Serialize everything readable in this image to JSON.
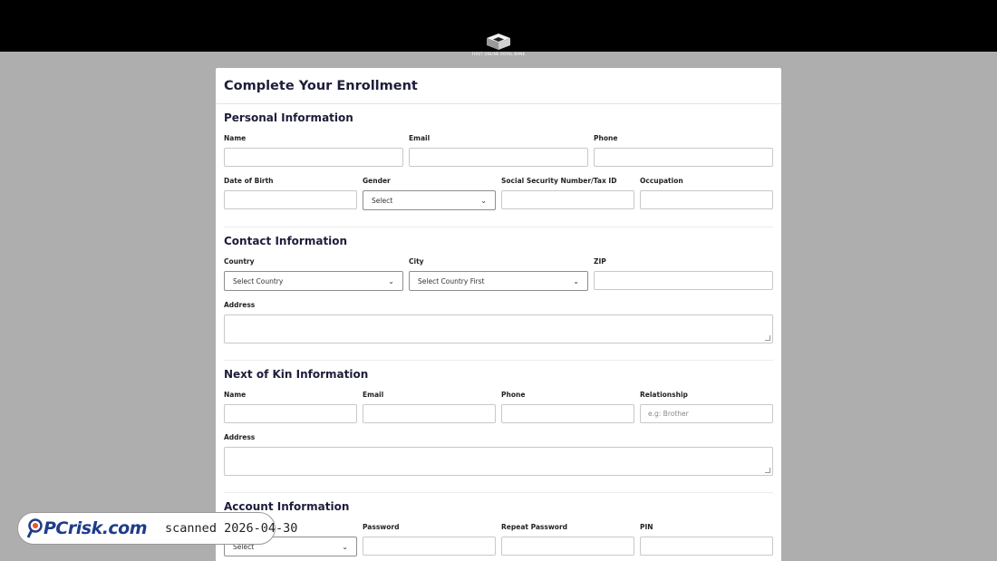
{
  "header": {
    "logo_text": "FIRST ONLINE ROYAL BANK"
  },
  "form": {
    "title": "Complete Your Enrollment",
    "personal": {
      "title": "Personal Information",
      "name_label": "Name",
      "email_label": "Email",
      "phone_label": "Phone",
      "dob_label": "Date of Birth",
      "gender_label": "Gender",
      "gender_value": "Select",
      "ssn_label": "Social Security Number/Tax ID",
      "occupation_label": "Occupation"
    },
    "contact": {
      "title": "Contact Information",
      "country_label": "Country",
      "country_value": "Select Country",
      "city_label": "City",
      "city_value": "Select Country First",
      "zip_label": "ZIP",
      "address_label": "Address"
    },
    "kin": {
      "title": "Next of Kin Information",
      "name_label": "Name",
      "email_label": "Email",
      "phone_label": "Phone",
      "relationship_label": "Relationship",
      "relationship_placeholder": "e.g: Brother",
      "address_label": "Address"
    },
    "account": {
      "title": "Account Information",
      "currency_value": "Select",
      "password_label": "Password",
      "repeat_password_label": "Repeat Password",
      "pin_label": "PIN"
    }
  },
  "watermark": {
    "brand": "PC",
    "brand_suffix": "risk.com",
    "scan_text": "scanned 2026-04-30"
  }
}
